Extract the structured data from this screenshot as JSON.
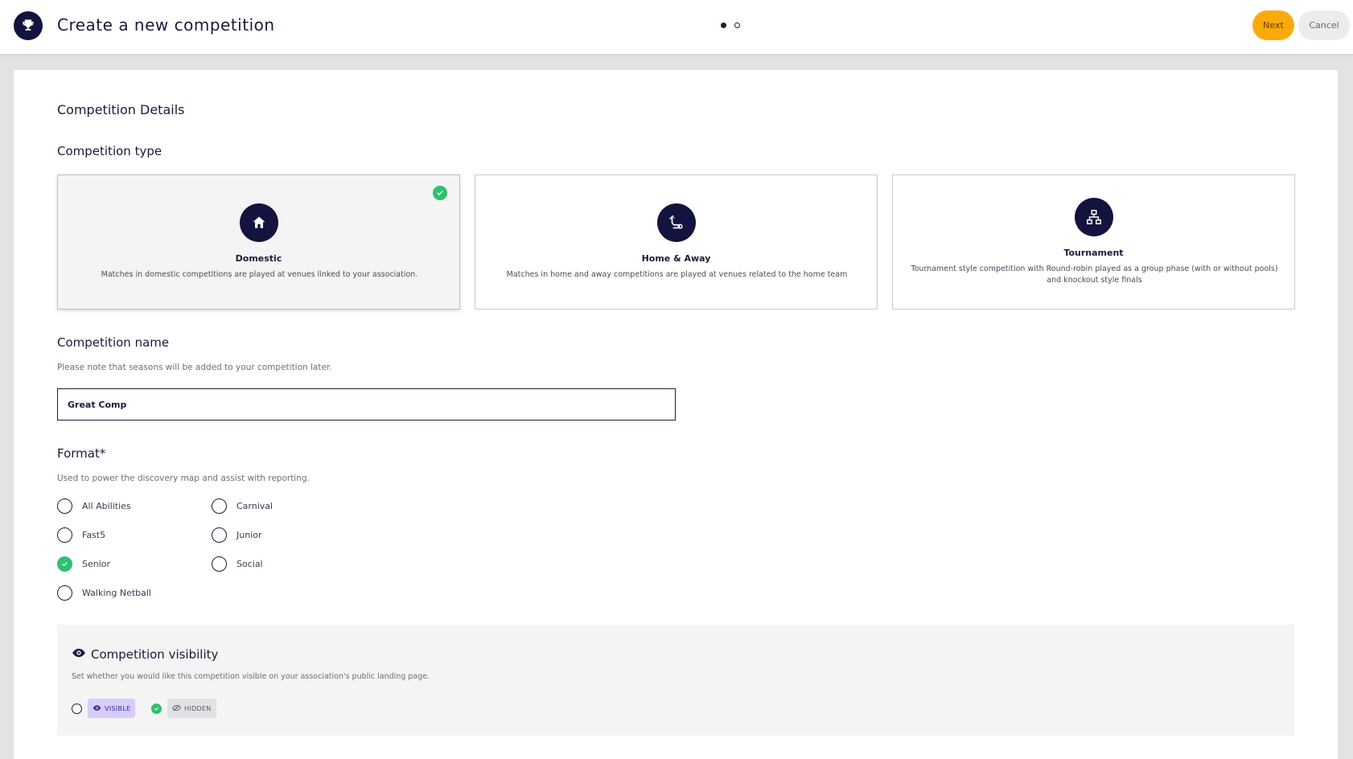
{
  "header": {
    "title": "Create a new competition",
    "next_label": "Next",
    "cancel_label": "Cancel",
    "steps_total": 2,
    "current_step": 1
  },
  "details": {
    "title": "Competition Details",
    "type_heading": "Competition type",
    "types": [
      {
        "name": "Domestic",
        "description": "Matches in domestic competitions are played at venues linked to your association.",
        "icon": "house-icon",
        "selected": true
      },
      {
        "name": "Home & Away",
        "description": "Matches in home and away competitions are played at venues related to the home team",
        "icon": "route-icon",
        "selected": false
      },
      {
        "name": "Tournament",
        "description": "Tournament style competition with Round-robin played as a group phase (with or without pools) and knockout style finals",
        "icon": "bracket-icon",
        "selected": false
      }
    ]
  },
  "name_section": {
    "heading": "Competition name",
    "helper": "Please note that seasons will be added to your competition later.",
    "value": "Great Comp"
  },
  "format": {
    "heading": "Format*",
    "helper": "Used to power the discovery map and assist with reporting.",
    "options": [
      {
        "label": "All Abilities",
        "checked": false
      },
      {
        "label": "Carnival",
        "checked": false
      },
      {
        "label": "Fast5",
        "checked": false
      },
      {
        "label": "Junior",
        "checked": false
      },
      {
        "label": "Senior",
        "checked": true
      },
      {
        "label": "Social",
        "checked": false
      },
      {
        "label": "Walking Netball",
        "checked": false
      }
    ]
  },
  "visibility": {
    "heading": "Competition visibility",
    "helper": "Set whether you would like this competition visible on your association's public landing page.",
    "visible_label": "VISIBLE",
    "hidden_label": "HIDDEN",
    "selected": "hidden"
  },
  "colors": {
    "accent_navy": "#13133f",
    "next_orange": "#fbaa0c",
    "check_green": "#2fbf71",
    "visible_chip": "#d7cdfc"
  }
}
